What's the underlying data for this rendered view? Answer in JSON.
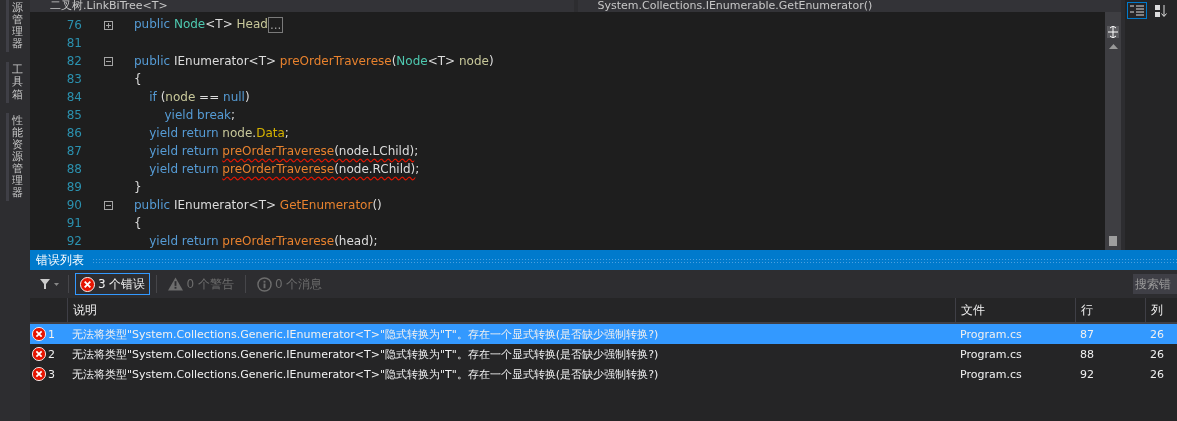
{
  "side_tabs": [
    {
      "label": "源管理器",
      "selected": false
    },
    {
      "label": "工具箱",
      "selected": false
    },
    {
      "label": "性能资源管理器",
      "selected": false
    }
  ],
  "nav_bar": {
    "left": "二叉树.LinkBiTree<T>",
    "right": "System.Collections.IEnumerable.GetEnumerator()"
  },
  "editor": {
    "lines": [
      {
        "number": "76",
        "fold_button": true,
        "collapsed": true,
        "tokens": [
          {
            "text": "public ",
            "kind": "keyword"
          },
          {
            "text": "Node",
            "kind": "type"
          },
          {
            "text": "<T> ",
            "kind": "plain"
          },
          {
            "text": "Head",
            "kind": "name"
          },
          {
            "text": "...",
            "kind": "collapsed"
          }
        ]
      },
      {
        "number": "81",
        "fold_button": false
      },
      {
        "number": "82",
        "fold_button": true,
        "collapsed": false,
        "tokens": [
          {
            "text": "public ",
            "kind": "keyword"
          },
          {
            "text": "IEnumerator",
            "kind": "plain"
          },
          {
            "text": "<T> ",
            "kind": "plain"
          },
          {
            "text": "preOrderTraverese",
            "kind": "method"
          },
          {
            "text": "(",
            "kind": "plain"
          },
          {
            "text": "Node",
            "kind": "type"
          },
          {
            "text": "<T> ",
            "kind": "plain"
          },
          {
            "text": "node",
            "kind": "name"
          },
          {
            "text": ")",
            "kind": "plain"
          }
        ]
      },
      {
        "number": "83",
        "fold_button": false,
        "tokens": [
          {
            "text": "{",
            "kind": "plain"
          }
        ]
      },
      {
        "number": "84",
        "fold_button": false,
        "tokens": [
          {
            "text": "    if ",
            "kind": "keyword"
          },
          {
            "text": "(",
            "kind": "plain"
          },
          {
            "text": "node",
            "kind": "name"
          },
          {
            "text": " == ",
            "kind": "plain"
          },
          {
            "text": "null",
            "kind": "keyword"
          },
          {
            "text": ")",
            "kind": "plain"
          }
        ]
      },
      {
        "number": "85",
        "fold_button": false,
        "tokens": [
          {
            "text": "        yield break",
            "kind": "keyword"
          },
          {
            "text": ";",
            "kind": "plain"
          }
        ]
      },
      {
        "number": "86",
        "fold_button": false,
        "tokens": [
          {
            "text": "    yield return ",
            "kind": "keyword"
          },
          {
            "text": "node",
            "kind": "name"
          },
          {
            "text": ".",
            "kind": "plain"
          },
          {
            "text": "Data",
            "kind": "property"
          },
          {
            "text": ";",
            "kind": "plain"
          }
        ]
      },
      {
        "number": "87",
        "fold_button": false,
        "tokens": [
          {
            "text": "    yield return ",
            "kind": "keyword"
          },
          {
            "text": "preOrderTraverese",
            "kind": "method",
            "error": true
          },
          {
            "text": "(node.LChild)",
            "kind": "plain",
            "error": true
          },
          {
            "text": ";",
            "kind": "plain"
          }
        ]
      },
      {
        "number": "88",
        "fold_button": false,
        "tokens": [
          {
            "text": "    yield return ",
            "kind": "keyword"
          },
          {
            "text": "preOrderTraverese",
            "kind": "method",
            "error": true
          },
          {
            "text": "(node.RChild)",
            "kind": "plain",
            "error": true
          },
          {
            "text": ";",
            "kind": "plain"
          }
        ]
      },
      {
        "number": "89",
        "fold_button": false,
        "tokens": [
          {
            "text": "}",
            "kind": "plain"
          }
        ]
      },
      {
        "number": "90",
        "fold_button": true,
        "collapsed": false,
        "tokens": [
          {
            "text": "public ",
            "kind": "keyword"
          },
          {
            "text": "IEnumerator",
            "kind": "plain"
          },
          {
            "text": "<T> ",
            "kind": "plain"
          },
          {
            "text": "GetEnumerator",
            "kind": "method"
          },
          {
            "text": "()",
            "kind": "plain"
          }
        ]
      },
      {
        "number": "91",
        "fold_button": false,
        "tokens": [
          {
            "text": "{",
            "kind": "plain"
          }
        ]
      },
      {
        "number": "92",
        "fold_button": false,
        "tokens": [
          {
            "text": "    yield return ",
            "kind": "keyword"
          },
          {
            "text": "preOrderTraverese",
            "kind": "method"
          },
          {
            "text": "(head);",
            "kind": "plain"
          }
        ]
      }
    ]
  },
  "error_list": {
    "title": "错误列表",
    "filters": [
      {
        "label": "3 个错误",
        "kind": "error",
        "selected": true,
        "disabled": false
      },
      {
        "label": "0 个警告",
        "kind": "warning",
        "selected": false,
        "disabled": true
      },
      {
        "label": "0 个消息",
        "kind": "info",
        "selected": false,
        "disabled": true
      }
    ],
    "search": {
      "placeholder": "搜索错"
    },
    "columns": [
      "说明",
      "文件",
      "行",
      "列"
    ],
    "rows": [
      {
        "index": "1",
        "description": "无法将类型\"System.Collections.Generic.IEnumerator<T>\"隐式转换为\"T\"。存在一个显式转换(是否缺少强制转换?)",
        "file": "Program.cs",
        "line": "87",
        "column": "26",
        "selected": true
      },
      {
        "index": "2",
        "description": "无法将类型\"System.Collections.Generic.IEnumerator<T>\"隐式转换为\"T\"。存在一个显式转换(是否缺少强制转换?)",
        "file": "Program.cs",
        "line": "88",
        "column": "26",
        "selected": false
      },
      {
        "index": "3",
        "description": "无法将类型\"System.Collections.Generic.IEnumerator<T>\"隐式转换为\"T\"。存在一个显式转换(是否缺少强制转换?)",
        "file": "Program.cs",
        "line": "92",
        "column": "26",
        "selected": false
      }
    ]
  }
}
